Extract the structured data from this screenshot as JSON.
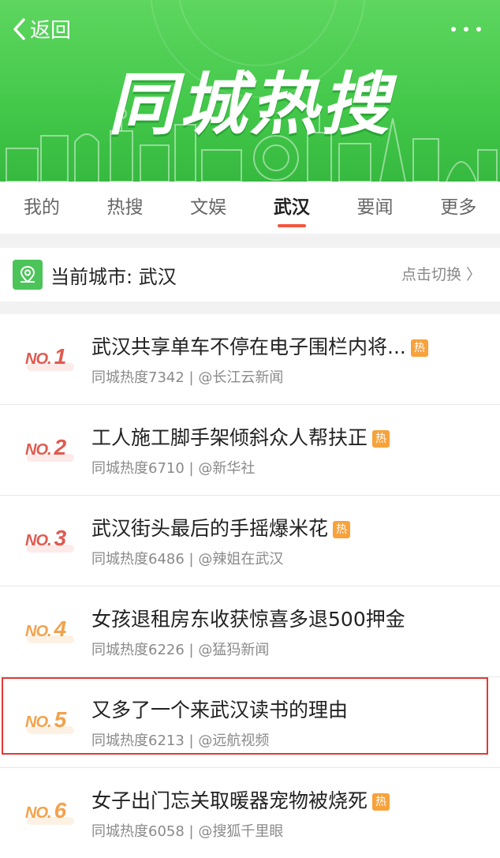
{
  "header": {
    "back_label": "返回",
    "hero_title": "同城热搜"
  },
  "tabs": [
    {
      "label": "我的"
    },
    {
      "label": "热搜"
    },
    {
      "label": "文娱"
    },
    {
      "label": "武汉",
      "active": true
    },
    {
      "label": "要闻"
    },
    {
      "label": "更多"
    }
  ],
  "city": {
    "label": "当前城市: 武汉",
    "switch_label": "点击切换 〉"
  },
  "items": [
    {
      "no": "NO.",
      "num": "1",
      "title": "武汉共享单车不停在电子围栏内将...",
      "hot": "热",
      "meta": "同城热度7342 | @长江云新闻",
      "rank_color": "#e05a4f"
    },
    {
      "no": "NO.",
      "num": "2",
      "title": "工人施工脚手架倾斜众人帮扶正",
      "hot": "热",
      "meta": "同城热度6710 | @新华社",
      "rank_color": "#e05a4f"
    },
    {
      "no": "NO.",
      "num": "3",
      "title": "武汉街头最后的手摇爆米花",
      "hot": "热",
      "meta": "同城热度6486 | @辣姐在武汉",
      "rank_color": "#e05a4f"
    },
    {
      "no": "NO.",
      "num": "4",
      "title": "女孩退租房东收获惊喜多退500押金",
      "hot": "",
      "meta": "同城热度6226 | @猛犸新闻",
      "rank_color": "#f3a14a"
    },
    {
      "no": "NO.",
      "num": "5",
      "title": "又多了一个来武汉读书的理由",
      "hot": "",
      "meta": "同城热度6213 | @远航视频",
      "rank_color": "#f3a14a"
    },
    {
      "no": "NO.",
      "num": "6",
      "title": "女子出门忘关取暖器宠物被烧死",
      "hot": "热",
      "meta": "同城热度6058 | @搜狐千里眼",
      "rank_color": "#f3a14a"
    }
  ]
}
